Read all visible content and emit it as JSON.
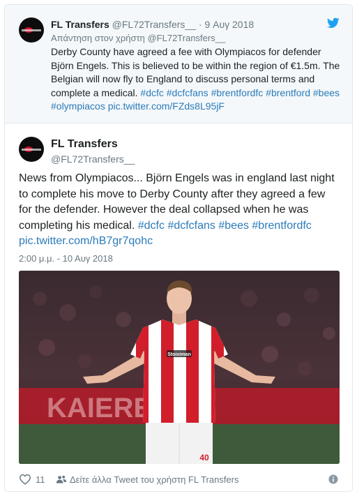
{
  "parent_tweet": {
    "display_name": "FL Transfers",
    "handle": "@FL72Transfers__",
    "separator": "·",
    "date": "9 Αυγ 2018",
    "reply_context": "Απάντηση στον χρήστη @FL72Transfers__",
    "text": "Derby County have agreed a fee with Olympiacos for defender Björn Engels. This is believed to be within the region of €1.5m. The Belgian will now fly to England to discuss personal terms and complete a medical. ",
    "hashtags": "#dcfc #dcfcfans #brentfordfc #brentford #bees #olympiacos pic.twitter.com/FZds8L95jF"
  },
  "main_tweet": {
    "display_name": "FL Transfers",
    "handle": "@FL72Transfers__",
    "text": "News from Olympiacos... Björn Engels was in england last night to complete his move to Derby County after they agreed a few for the defender. However the deal collapsed when he was completing his medical. ",
    "hashtags": "#dcfc #dcfcfans #bees #brentfordfc",
    "pic_link": "pic.twitter.com/hB7gr7qohc",
    "timestamp": "2:00 μ.μ. - 10 Αυγ 2018",
    "photo_shirt_sponsor": "Stoiximan",
    "photo_shirt_number": "40",
    "photo_banner_text": "KAIEREI"
  },
  "footer": {
    "likes": "11",
    "more_tweets_label": "Δείτε άλλα Tweet του χρήστη FL Transfers"
  },
  "icons": {
    "twitter_bird": "bird-icon",
    "like": "heart-icon",
    "people": "people-icon",
    "info": "info-icon"
  },
  "colors": {
    "link": "#2b7bb9",
    "muted": "#697882",
    "twitter_blue": "#1da1f2",
    "parent_bg": "#f5f8fa",
    "shirt_red": "#d21e2b"
  }
}
